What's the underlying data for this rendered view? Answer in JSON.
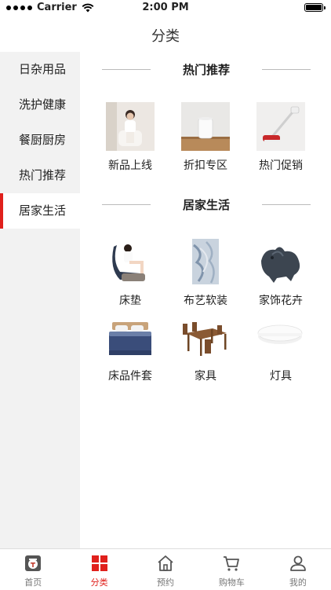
{
  "status": {
    "carrier": "Carrier",
    "time": "2:00 PM"
  },
  "nav": {
    "title": "分类"
  },
  "sidebar": {
    "items": [
      {
        "label": "日杂用品"
      },
      {
        "label": "洗护健康"
      },
      {
        "label": "餐厨厨房"
      },
      {
        "label": "热门推荐"
      },
      {
        "label": "居家生活",
        "active": true
      }
    ]
  },
  "sections": [
    {
      "title": "热门推荐",
      "items": [
        {
          "label": "新品上线",
          "icon": "woman-sitting-photo"
        },
        {
          "label": "折扣专区",
          "icon": "humidifier-photo"
        },
        {
          "label": "热门促销",
          "icon": "vacuum-cleaner-photo"
        }
      ]
    },
    {
      "title": "居家生活",
      "items": [
        {
          "label": "床垫",
          "icon": "massage-chair-photo"
        },
        {
          "label": "布艺软装",
          "icon": "rug-photo"
        },
        {
          "label": "家饰花卉",
          "icon": "statue-photo"
        },
        {
          "label": "床品件套",
          "icon": "bedding-photo"
        },
        {
          "label": "家具",
          "icon": "dining-table-photo"
        },
        {
          "label": "灯具",
          "icon": "ceiling-lamp-photo"
        }
      ]
    }
  ],
  "tabbar": {
    "items": [
      {
        "label": "首页",
        "icon": "home-logo-icon"
      },
      {
        "label": "分类",
        "icon": "category-grid-icon",
        "active": true
      },
      {
        "label": "预约",
        "icon": "house-icon"
      },
      {
        "label": "购物车",
        "icon": "cart-icon"
      },
      {
        "label": "我的",
        "icon": "person-icon"
      }
    ]
  },
  "colors": {
    "accent": "#e0201c",
    "sidebar_bg": "#f2f2f2"
  }
}
